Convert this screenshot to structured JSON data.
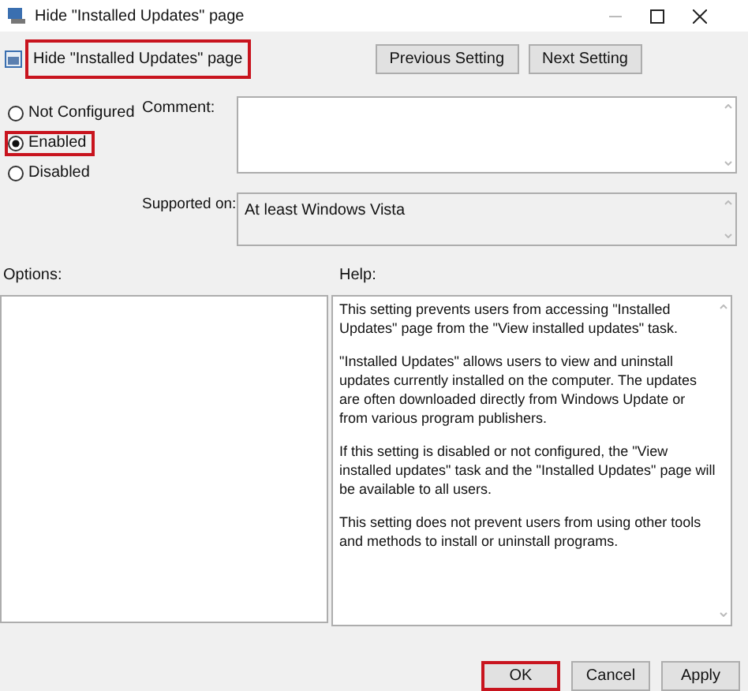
{
  "window": {
    "title": "Hide \"Installed Updates\" page"
  },
  "setting": {
    "title": "Hide \"Installed Updates\" page",
    "highlighted": true
  },
  "nav_buttons": [
    {
      "label": "Previous Setting"
    },
    {
      "label": "Next Setting"
    }
  ],
  "state_options": [
    {
      "label": "Not Configured",
      "selected": false,
      "highlighted": false
    },
    {
      "label": "Enabled",
      "selected": true,
      "highlighted": true
    },
    {
      "label": "Disabled",
      "selected": false,
      "highlighted": false
    }
  ],
  "comment": {
    "label": "Comment:"
  },
  "supported_on": {
    "label": "Supported on:",
    "value": "At least Windows Vista"
  },
  "options": {
    "label": "Options:"
  },
  "help": {
    "label": "Help:",
    "paragraphs": [
      "This setting prevents users from accessing \"Installed Updates\" page from the \"View installed updates\" task.",
      "\"Installed Updates\" allows users to view and uninstall updates currently installed on the computer.  The updates are often downloaded directly from Windows Update or from various program publishers.",
      "If this setting is disabled or not configured, the \"View installed updates\" task and the \"Installed Updates\" page will be available to all users.",
      "This setting does not prevent users from using other tools and methods to install or uninstall programs."
    ]
  },
  "footer_buttons": [
    {
      "label": "OK",
      "highlighted": true
    },
    {
      "label": "Cancel",
      "highlighted": false
    },
    {
      "label": "Apply",
      "highlighted": false
    }
  ]
}
